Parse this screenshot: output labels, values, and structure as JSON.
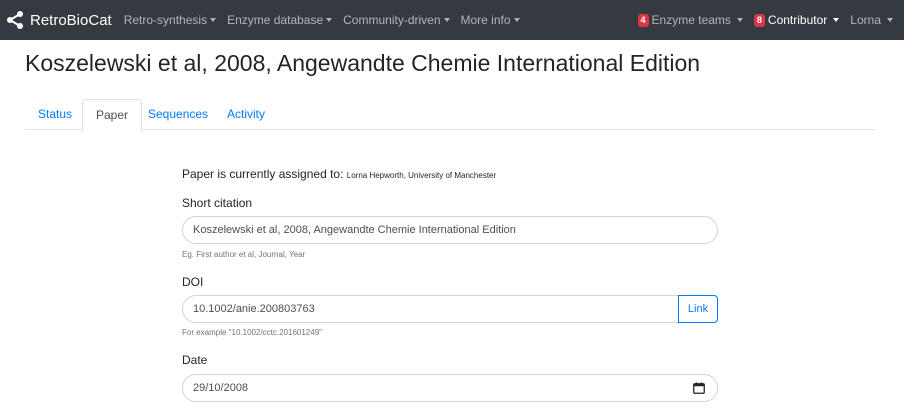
{
  "navbar": {
    "brand": "RetroBioCat",
    "menus": [
      {
        "label": "Retro-synthesis"
      },
      {
        "label": "Enzyme database"
      },
      {
        "label": "Community-driven"
      },
      {
        "label": "More info"
      }
    ],
    "right": {
      "enzyme_teams_count": "4",
      "enzyme_teams_label": "Enzyme teams",
      "contributor_count": "8",
      "contributor_label": "Contributor",
      "user": "Lorna"
    }
  },
  "page": {
    "title": "Koszelewski et al, 2008, Angewandte Chemie International Edition"
  },
  "tabs": [
    {
      "label": "Status",
      "active": false
    },
    {
      "label": "Paper",
      "active": true
    },
    {
      "label": "Sequences",
      "active": false
    },
    {
      "label": "Activity",
      "active": false
    }
  ],
  "form": {
    "assigned_prefix": "Paper is currently assigned to:",
    "assigned_name": "Lorna Hepworth, University of Manchester",
    "short_citation_label": "Short citation",
    "short_citation_value": "Koszelewski et al, 2008, Angewandte Chemie International Edition",
    "short_citation_help": "Eg. First author et al, Journal, Year",
    "doi_label": "DOI",
    "doi_value": "10.1002/anie.200803763",
    "doi_link_button": "Link",
    "doi_help": "For example \"10.1002/cctc.201601249\"",
    "date_label": "Date",
    "date_value": "29/10/2008"
  },
  "colors": {
    "navbar_bg": "#343a40",
    "link": "#007bff",
    "badge": "#dc3545"
  }
}
